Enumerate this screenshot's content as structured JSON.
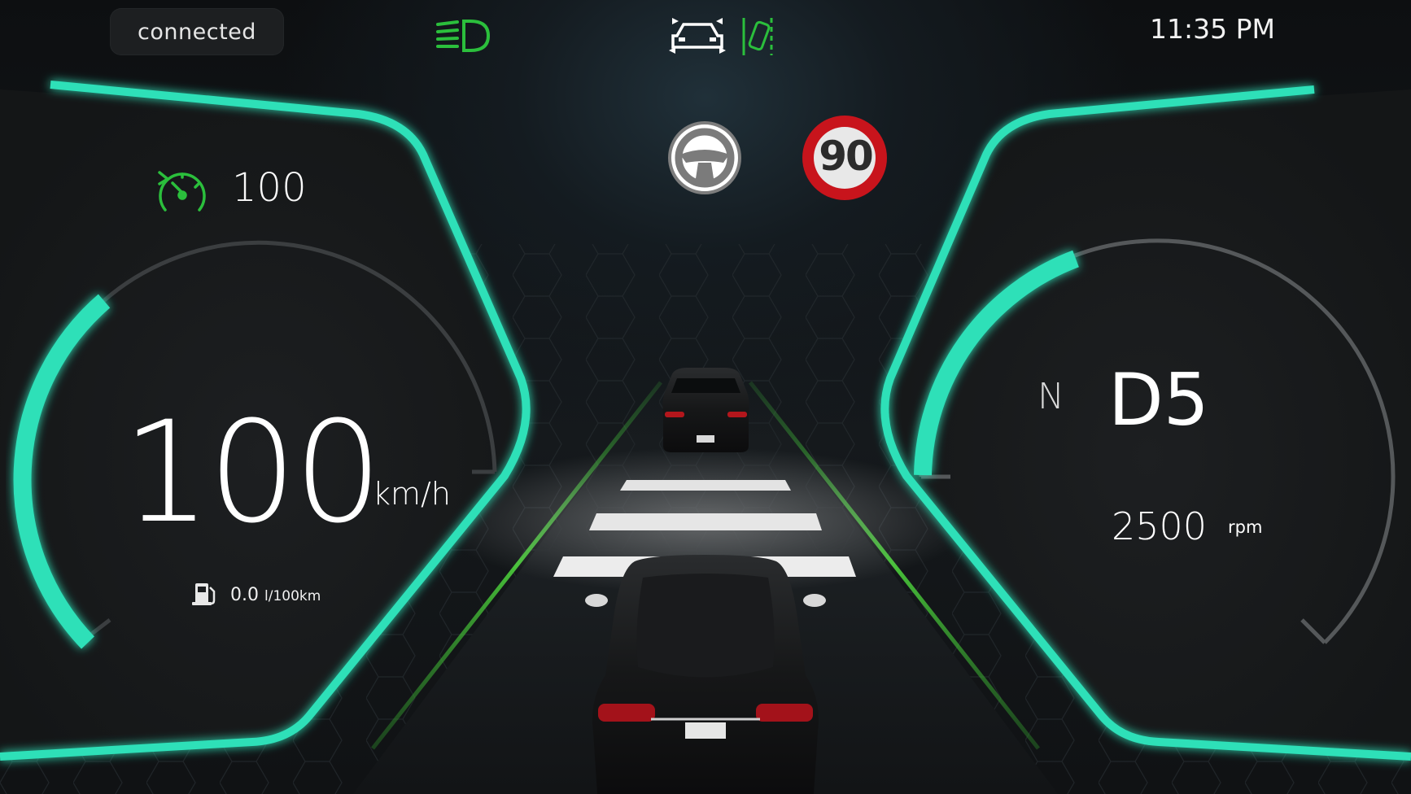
{
  "status": {
    "connection": "connected"
  },
  "clock": {
    "time": "11:35 PM"
  },
  "indicators": {
    "headlight_icon": "low-beam-headlight-icon",
    "lane_assist_icon": "car-distance-assist-icon",
    "lane_keep_icon": "lane-keep-icon",
    "steering_icon": "steering-wheel-icon",
    "active_color": "#2bbf3c"
  },
  "speed_limit": {
    "value": "90",
    "ring_color": "#c8141c"
  },
  "cruise": {
    "icon": "cruise-control-gauge-icon",
    "set_speed": "100"
  },
  "speed": {
    "value": "100",
    "unit": "km/h",
    "gauge_fill": 0.33
  },
  "consumption": {
    "icon": "fuel-pump-icon",
    "value": "0.0",
    "unit": "l/100km"
  },
  "gear": {
    "mode": "N",
    "current": "D5"
  },
  "tachometer": {
    "value": "2500",
    "unit": "rpm",
    "gauge_fill": 0.32
  },
  "accent_color": "#2de0b8"
}
